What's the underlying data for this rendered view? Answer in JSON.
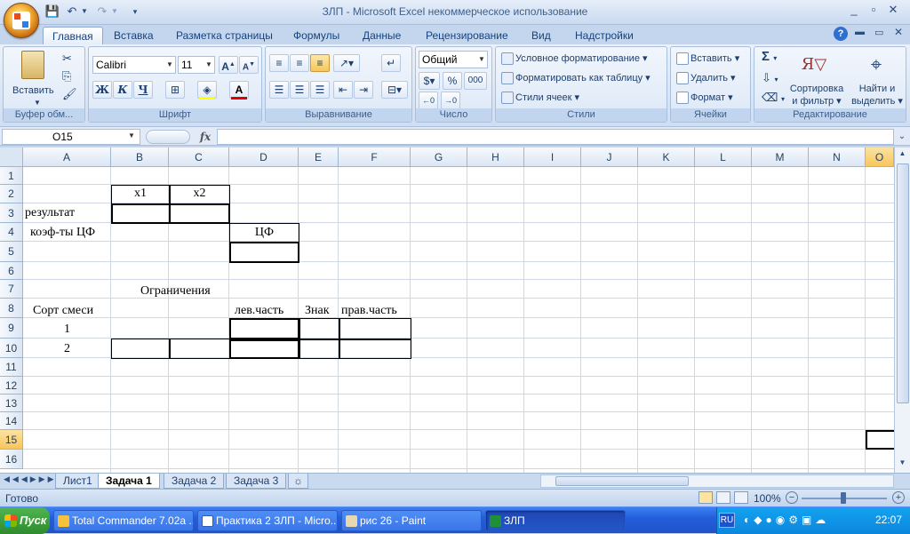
{
  "window": {
    "title": "ЗЛП - Microsoft Excel некоммерческое использование"
  },
  "ribbon": {
    "tabs": [
      "Главная",
      "Вставка",
      "Разметка страницы",
      "Формулы",
      "Данные",
      "Рецензирование",
      "Вид",
      "Надстройки"
    ],
    "clipboard": {
      "paste": "Вставить",
      "label": "Буфер обм..."
    },
    "font": {
      "name": "Calibri",
      "size": "11",
      "bold": "Ж",
      "italic": "К",
      "underline": "Ч",
      "grow": "A",
      "shrink": "A",
      "color_letter": "A",
      "label": "Шрифт"
    },
    "alignment": {
      "label": "Выравнивание"
    },
    "number": {
      "format": "Общий",
      "percent": "%",
      "thousands": "000",
      "label": "Число"
    },
    "styles": {
      "conditional": "Условное форматирование",
      "as_table": "Форматировать как таблицу",
      "cell_styles": "Стили ячеек",
      "label": "Стили"
    },
    "cells": {
      "insert": "Вставить",
      "delete": "Удалить",
      "format": "Формат",
      "label": "Ячейки"
    },
    "editing": {
      "sum": "Σ",
      "sort_line1": "Сортировка",
      "sort_line2": "и фильтр",
      "find_line1": "Найти и",
      "find_line2": "выделить",
      "label": "Редактирование"
    }
  },
  "formula_bar": {
    "name_box": "O15",
    "fx": "fx",
    "value": ""
  },
  "grid": {
    "columns": [
      "A",
      "B",
      "C",
      "D",
      "E",
      "F",
      "G",
      "H",
      "I",
      "J",
      "K",
      "L",
      "M",
      "N",
      "O"
    ],
    "rows": [
      "1",
      "2",
      "3",
      "4",
      "5",
      "6",
      "7",
      "8",
      "9",
      "10",
      "11",
      "12",
      "13",
      "14",
      "15",
      "16"
    ],
    "cells": {
      "B2": "x1",
      "C2": "x2",
      "A3": "результат",
      "A4": "коэф-ты ЦФ",
      "D4": "ЦФ",
      "B7": "Ограничения",
      "A8": "Сорт смеси",
      "D8": "лев.часть",
      "E8": "Знак",
      "F8": "прав.часть",
      "A9": "1",
      "A10": "2"
    },
    "selected_cell": "O15"
  },
  "sheets": {
    "tabs": [
      "Лист1",
      "Задача 1",
      "Задача 2",
      "Задача 3"
    ],
    "active": "Задача 1"
  },
  "status": {
    "ready": "Готово",
    "zoom": "100%"
  },
  "taskbar": {
    "start": "Пуск",
    "tasks": [
      "Total Commander 7.02a ...",
      "Практика 2 ЗЛП - Micro...",
      "рис 26 - Paint",
      "ЗЛП"
    ],
    "lang": "RU",
    "clock": "22:07"
  },
  "colors": {
    "accent": "#c4d6ee",
    "selection": "#f8c65b",
    "taskbar": "#245edb"
  }
}
